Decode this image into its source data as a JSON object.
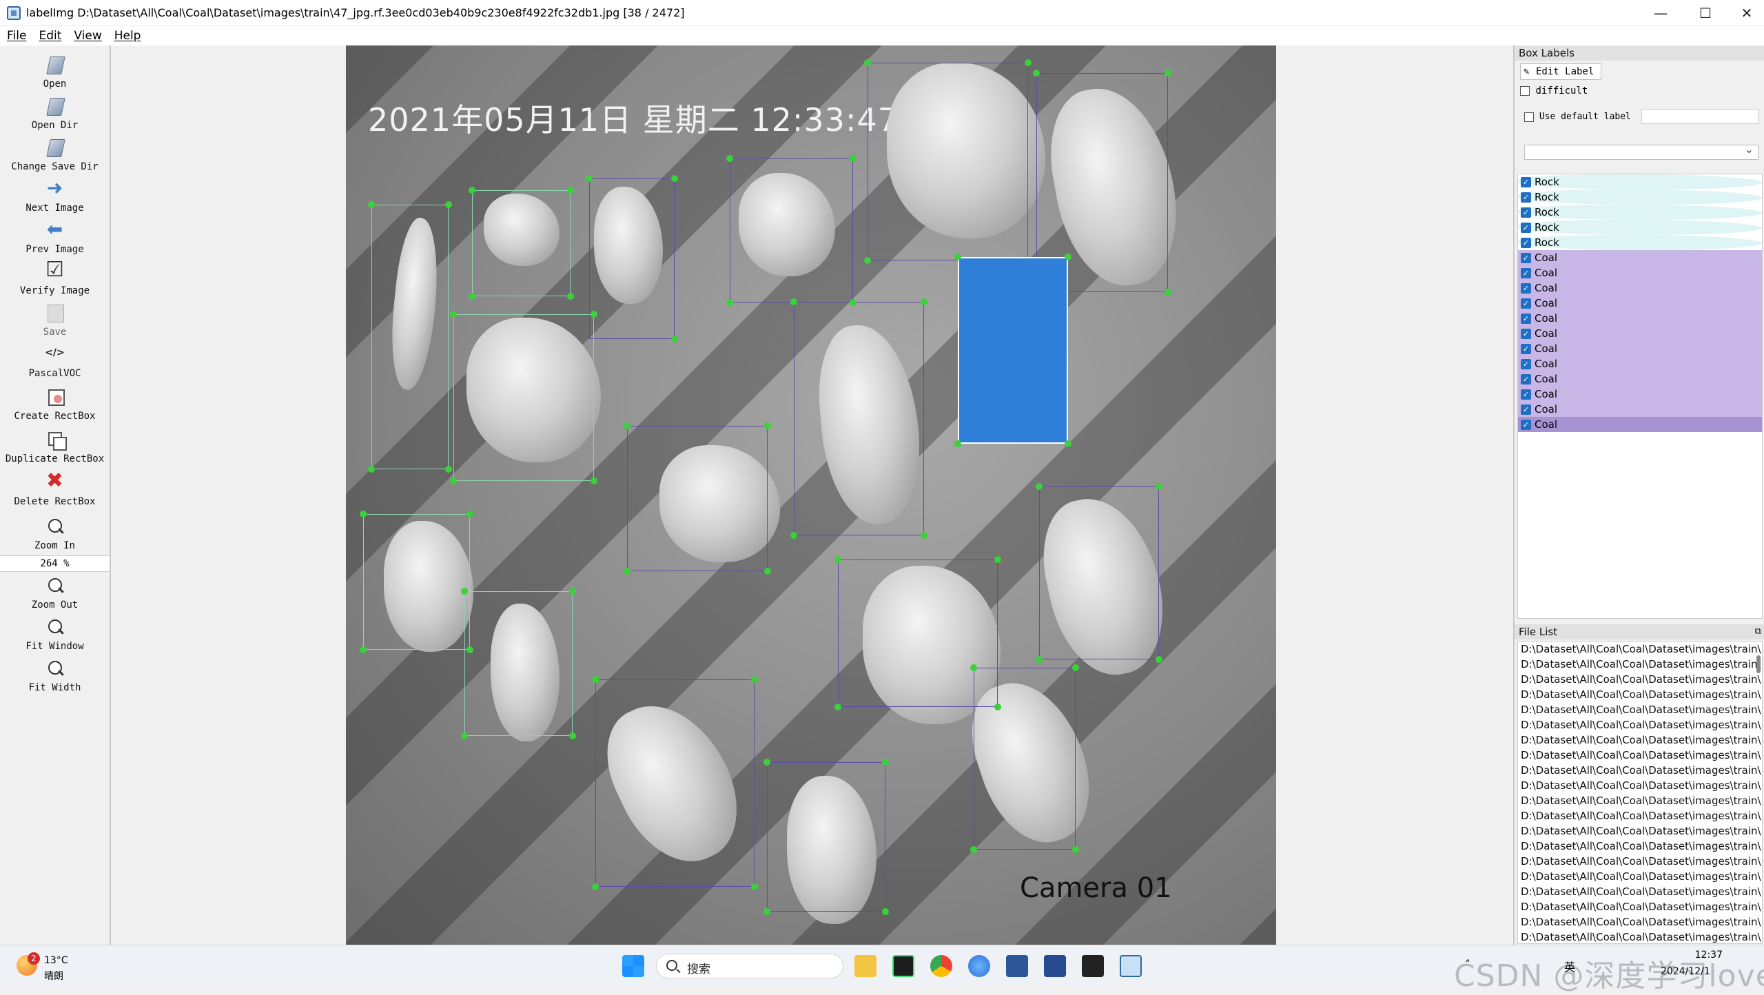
{
  "window": {
    "title": "labelImg D:\\Dataset\\All\\Coal\\Coal\\Dataset\\images\\train\\47_jpg.rf.3ee0cd03eb40b9c230e8f4922fc32db1.jpg [38 / 2472]",
    "minimize": "—",
    "maximize": "☐",
    "close": "✕"
  },
  "menu": [
    "File",
    "Edit",
    "View",
    "Help"
  ],
  "toolbar": {
    "open": "Open",
    "open_dir": "Open Dir",
    "change_save_dir": "Change Save Dir",
    "next_image": "Next Image",
    "prev_image": "Prev Image",
    "verify_image": "Verify Image",
    "save": "Save",
    "format": "PascalVOC",
    "create_rectbox": "Create RectBox",
    "duplicate_rectbox": "Duplicate RectBox",
    "delete_rectbox": "Delete RectBox",
    "zoom_in": "Zoom In",
    "zoom_value": "264 %",
    "zoom_out": "Zoom Out",
    "fit_window": "Fit Window",
    "fit_width": "Fit Width"
  },
  "image": {
    "datetime_overlay": "2021年05月11日 星期二 12:33:47",
    "camera_overlay": "Camera 01"
  },
  "box_labels": {
    "title": "Box Labels",
    "edit_label": "Edit Label",
    "difficult": "difficult",
    "use_default_label": "Use default label",
    "default_label_value": "",
    "labels": [
      {
        "name": "Rock",
        "class": "rock",
        "checked": true
      },
      {
        "name": "Rock",
        "class": "rock",
        "checked": true
      },
      {
        "name": "Rock",
        "class": "rock",
        "checked": true
      },
      {
        "name": "Rock",
        "class": "rock",
        "checked": true
      },
      {
        "name": "Rock",
        "class": "rock",
        "checked": true
      },
      {
        "name": "Coal",
        "class": "coal",
        "checked": true
      },
      {
        "name": "Coal",
        "class": "coal",
        "checked": true
      },
      {
        "name": "Coal",
        "class": "coal",
        "checked": true
      },
      {
        "name": "Coal",
        "class": "coal",
        "checked": true
      },
      {
        "name": "Coal",
        "class": "coal",
        "checked": true
      },
      {
        "name": "Coal",
        "class": "coal",
        "checked": true
      },
      {
        "name": "Coal",
        "class": "coal",
        "checked": true
      },
      {
        "name": "Coal",
        "class": "coal",
        "checked": true
      },
      {
        "name": "Coal",
        "class": "coal",
        "checked": true
      },
      {
        "name": "Coal",
        "class": "coal",
        "checked": true
      },
      {
        "name": "Coal",
        "class": "coal",
        "checked": true
      },
      {
        "name": "Coal",
        "class": "coal",
        "checked": true,
        "selected": true
      }
    ]
  },
  "file_list": {
    "title": "File List",
    "undock": "⧉",
    "items": [
      "D:\\Dataset\\All\\Coal\\Coal\\Dataset\\images\\train\\",
      "D:\\Dataset\\All\\Coal\\Coal\\Dataset\\images\\train\\",
      "D:\\Dataset\\All\\Coal\\Coal\\Dataset\\images\\train\\",
      "D:\\Dataset\\All\\Coal\\Coal\\Dataset\\images\\train\\",
      "D:\\Dataset\\All\\Coal\\Coal\\Dataset\\images\\train\\",
      "D:\\Dataset\\All\\Coal\\Coal\\Dataset\\images\\train\\",
      "D:\\Dataset\\All\\Coal\\Coal\\Dataset\\images\\train\\",
      "D:\\Dataset\\All\\Coal\\Coal\\Dataset\\images\\train\\",
      "D:\\Dataset\\All\\Coal\\Coal\\Dataset\\images\\train\\",
      "D:\\Dataset\\All\\Coal\\Coal\\Dataset\\images\\train\\",
      "D:\\Dataset\\All\\Coal\\Coal\\Dataset\\images\\train\\",
      "D:\\Dataset\\All\\Coal\\Coal\\Dataset\\images\\train\\",
      "D:\\Dataset\\All\\Coal\\Coal\\Dataset\\images\\train\\",
      "D:\\Dataset\\All\\Coal\\Coal\\Dataset\\images\\train\\",
      "D:\\Dataset\\All\\Coal\\Coal\\Dataset\\images\\train\\",
      "D:\\Dataset\\All\\Coal\\Coal\\Dataset\\images\\train\\",
      "D:\\Dataset\\All\\Coal\\Coal\\Dataset\\images\\train\\",
      "D:\\Dataset\\All\\Coal\\Coal\\Dataset\\images\\train\\",
      "D:\\Dataset\\All\\Coal\\Coal\\Dataset\\images\\train\\",
      "D:\\Dataset\\All\\Coal\\Coal\\Dataset\\images\\train\\"
    ]
  },
  "taskbar": {
    "weather_badge": "2",
    "temperature": "13°C",
    "condition": "晴朗",
    "search_placeholder": "搜索",
    "ime": "英",
    "time": "12:37",
    "date": "2024/12/1",
    "watermark": "CSDN @深度学习lover"
  },
  "colors": {
    "rock_row": "#dff4f4",
    "coal_row": "#c8b6e6",
    "selected_box": "#2f7ed8",
    "vertex": "#3ad13a"
  }
}
